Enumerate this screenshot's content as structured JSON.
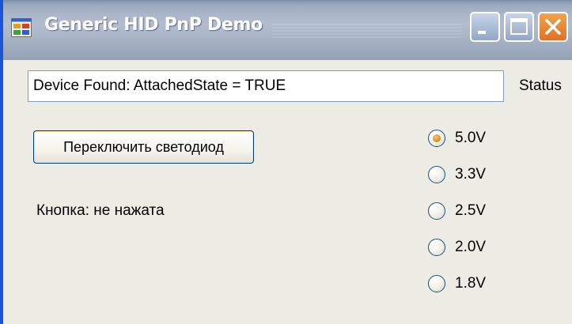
{
  "window": {
    "title": "Generic HID PnP Demo",
    "icon": "app-window-icon",
    "controls": {
      "minimize_icon": "minimize-icon",
      "maximize_icon": "maximize-icon",
      "close_icon": "close-icon"
    }
  },
  "status": {
    "value": "Device Found: AttachedState = TRUE",
    "label": "Status"
  },
  "toggle_button": {
    "label": "Переключить светодиод"
  },
  "button_state": {
    "text": "Кнопка: не нажата"
  },
  "voltage": {
    "selected": "5.0V",
    "options": [
      {
        "label": "5.0V",
        "checked": true
      },
      {
        "label": "3.3V",
        "checked": false
      },
      {
        "label": "2.5V",
        "checked": false
      },
      {
        "label": "2.0V",
        "checked": false
      },
      {
        "label": "1.8V",
        "checked": false
      }
    ]
  },
  "colors": {
    "title_text": "#ffffff",
    "client_background": "#ecebe4",
    "close_button": "#e0702a",
    "radio_dot": "#d88a1e"
  }
}
